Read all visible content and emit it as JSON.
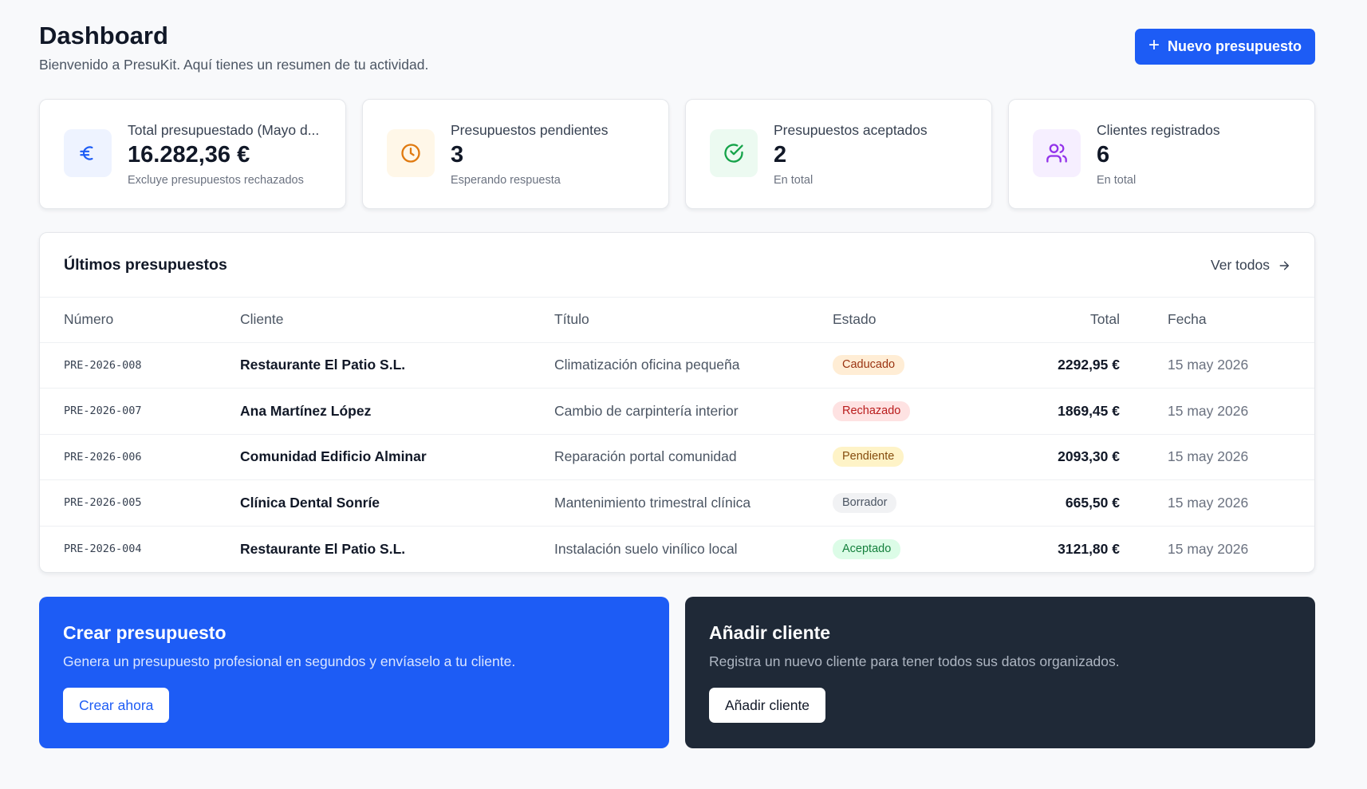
{
  "header": {
    "title": "Dashboard",
    "subtitle": "Bienvenido a PresuKit. Aquí tienes un resumen de tu actividad.",
    "new_button": "Nuevo presupuesto"
  },
  "stats": [
    {
      "label": "Total presupuestado (Mayo d...",
      "value": "16.282,36 €",
      "note": "Excluye presupuestos rechazados",
      "icon": "euro-icon",
      "color": "#1d5cf5",
      "bg": "#eef3ff"
    },
    {
      "label": "Presupuestos pendientes",
      "value": "3",
      "note": "Esperando respuesta",
      "icon": "clock-icon",
      "color": "#e07a10",
      "bg": "#fff7e8"
    },
    {
      "label": "Presupuestos aceptados",
      "value": "2",
      "note": "En total",
      "icon": "check-circle-icon",
      "color": "#16a34a",
      "bg": "#ecfaf1"
    },
    {
      "label": "Clientes registrados",
      "value": "6",
      "note": "En total",
      "icon": "users-icon",
      "color": "#9333ea",
      "bg": "#f6efff"
    }
  ],
  "table": {
    "title": "Últimos presupuestos",
    "view_all": "Ver todos",
    "columns": [
      "Número",
      "Cliente",
      "Título",
      "Estado",
      "Total",
      "Fecha"
    ],
    "rows": [
      {
        "numero": "PRE-2026-008",
        "cliente": "Restaurante El Patio S.L.",
        "titulo": "Climatización oficina pequeña",
        "estado": "Caducado",
        "total": "2292,95 €",
        "fecha": "15 may 2026"
      },
      {
        "numero": "PRE-2026-007",
        "cliente": "Ana Martínez López",
        "titulo": "Cambio de carpintería interior",
        "estado": "Rechazado",
        "total": "1869,45 €",
        "fecha": "15 may 2026"
      },
      {
        "numero": "PRE-2026-006",
        "cliente": "Comunidad Edificio Alminar",
        "titulo": "Reparación portal comunidad",
        "estado": "Pendiente",
        "total": "2093,30 €",
        "fecha": "15 may 2026"
      },
      {
        "numero": "PRE-2026-005",
        "cliente": "Clínica Dental Sonríe",
        "titulo": "Mantenimiento trimestral clínica",
        "estado": "Borrador",
        "total": "665,50 €",
        "fecha": "15 may 2026"
      },
      {
        "numero": "PRE-2026-004",
        "cliente": "Restaurante El Patio S.L.",
        "titulo": "Instalación suelo vinílico local",
        "estado": "Aceptado",
        "total": "3121,80 €",
        "fecha": "15 may 2026"
      }
    ],
    "status_colors": {
      "Caducado": {
        "bg": "#ffedd5",
        "fg": "#9a3412"
      },
      "Rechazado": {
        "bg": "#fee2e2",
        "fg": "#b91c1c"
      },
      "Pendiente": {
        "bg": "#fef3c7",
        "fg": "#854d0e"
      },
      "Borrador": {
        "bg": "#f1f2f4",
        "fg": "#4b5563"
      },
      "Aceptado": {
        "bg": "#dcfce7",
        "fg": "#15803d"
      }
    }
  },
  "promos": {
    "create": {
      "title": "Crear presupuesto",
      "text": "Genera un presupuesto profesional en segundos y envíaselo a tu cliente.",
      "button": "Crear ahora"
    },
    "client": {
      "title": "Añadir cliente",
      "text": "Registra un nuevo cliente para tener todos sus datos organizados.",
      "button": "Añadir cliente"
    }
  }
}
